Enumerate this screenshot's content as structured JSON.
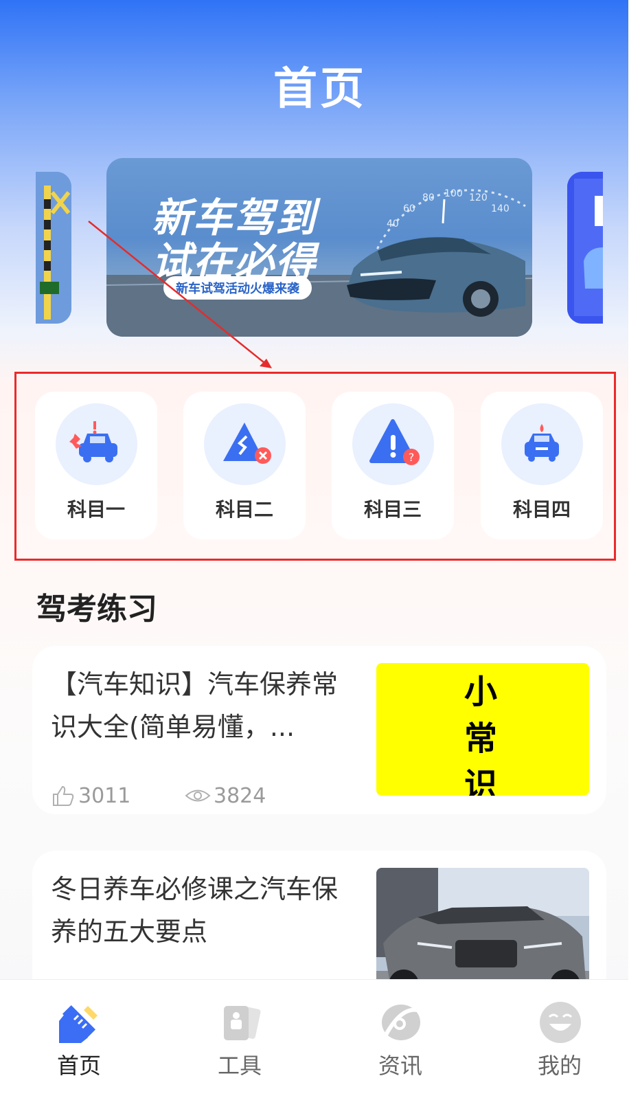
{
  "header": {
    "title": "首页"
  },
  "banner": {
    "line1": "新车驾到",
    "line2": "试在必得",
    "pill": "新车试驾活动火爆来袭",
    "speedo": [
      "40",
      "60",
      "80",
      "100",
      "120",
      "140"
    ]
  },
  "subjects": [
    {
      "label": "科目一",
      "icon": "car-crash-icon"
    },
    {
      "label": "科目二",
      "icon": "road-sign-error-icon"
    },
    {
      "label": "科目三",
      "icon": "warning-question-icon"
    },
    {
      "label": "科目四",
      "icon": "police-car-icon"
    }
  ],
  "section": {
    "title": "驾考练习"
  },
  "articles": [
    {
      "title": "【汽车知识】汽车保养常识大全(简单易懂，...",
      "likes": "3011",
      "views": "3824",
      "thumb_text": [
        "小",
        "常",
        "识"
      ]
    },
    {
      "title": "冬日养车必修课之汽车保养的五大要点"
    }
  ],
  "nav": [
    {
      "label": "首页",
      "icon": "home-ruler-icon",
      "active": true
    },
    {
      "label": "工具",
      "icon": "tools-icon",
      "active": false
    },
    {
      "label": "资讯",
      "icon": "news-icon",
      "active": false
    },
    {
      "label": "我的",
      "icon": "profile-face-icon",
      "active": false
    }
  ],
  "colors": {
    "accent": "#3b6ef5",
    "highlight_border": "#ea2a2a",
    "thumb_yellow": "#ffff00"
  }
}
